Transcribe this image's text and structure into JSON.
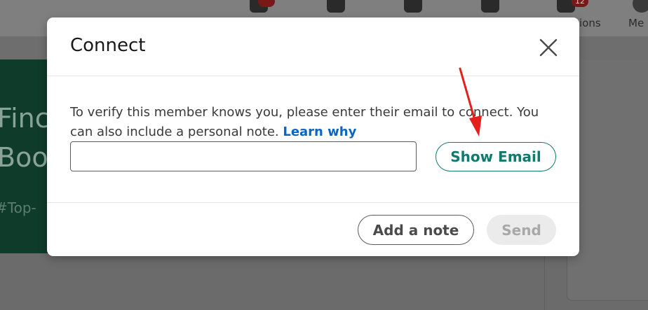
{
  "background": {
    "nav_labels": [
      "ions",
      "Me"
    ],
    "notification_badge": "12",
    "banner_lines": [
      "Finc",
      "Boo"
    ],
    "banner_tag": "#Top-"
  },
  "modal": {
    "title": "Connect",
    "close_icon": "close-icon",
    "message": "To verify this member knows you, please enter their email to connect. You can also include a personal note.",
    "learn_why_label": "Learn why",
    "email_input": {
      "value": "",
      "placeholder": ""
    },
    "show_email_label": "Show Email",
    "add_note_label": "Add a note",
    "send_label": "Send"
  },
  "colors": {
    "accent_teal": "#107a6f",
    "link_blue": "#0a66c2",
    "annotation_red": "#e3201b"
  }
}
